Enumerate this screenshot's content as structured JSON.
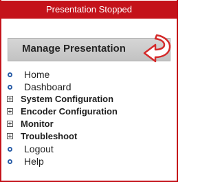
{
  "status": {
    "text": "Presentation Stopped",
    "color": "#c4121a"
  },
  "manage_button": {
    "label": "Manage Presentation",
    "icon": "curved-arrow-icon"
  },
  "menu": {
    "items": [
      {
        "label": "Home",
        "icon": "bullet-icon"
      },
      {
        "label": "Dashboard",
        "icon": "bullet-icon"
      },
      {
        "label": "System Configuration",
        "icon": "expand-icon"
      },
      {
        "label": "Encoder Configuration",
        "icon": "expand-icon"
      },
      {
        "label": "Monitor",
        "icon": "expand-icon"
      },
      {
        "label": "Troubleshoot",
        "icon": "expand-icon"
      },
      {
        "label": "Logout",
        "icon": "bullet-icon"
      },
      {
        "label": "Help",
        "icon": "bullet-icon"
      }
    ]
  }
}
